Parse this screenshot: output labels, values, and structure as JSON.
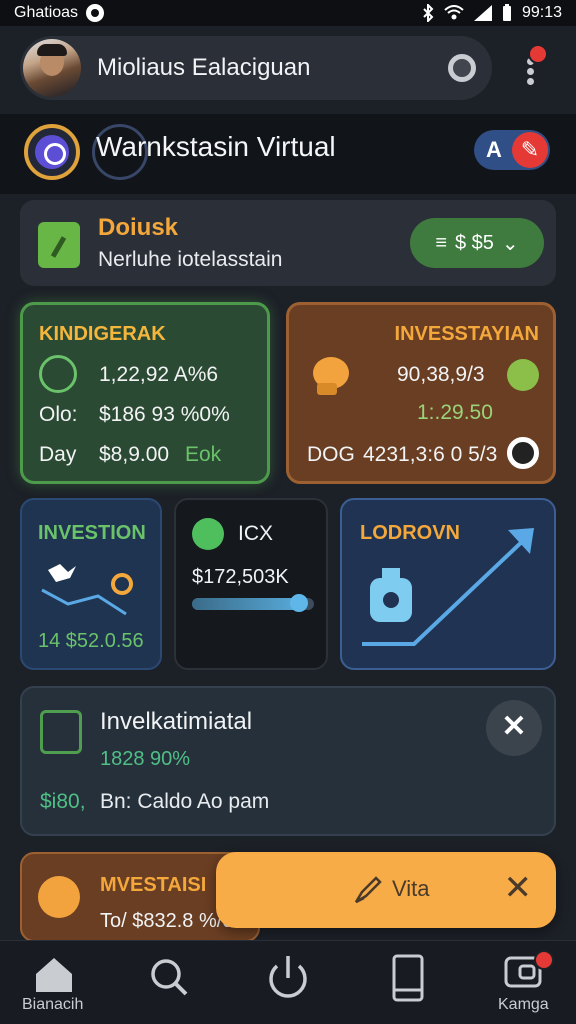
{
  "status_bar": {
    "carrier": "Ghatioas",
    "time": "99:13"
  },
  "profile": {
    "name": "Mioliaus Ealaciguan"
  },
  "app": {
    "title": "Warnkstasin Virtual",
    "action_label": "A"
  },
  "document": {
    "title": "Doiusk",
    "subtitle": "Nerluhe iotelasstain",
    "amount": "$ $5"
  },
  "cards": {
    "kinder": {
      "title": "KINDIGERAK",
      "row1": "1,22,92 A%6",
      "row2_label": "Olo:",
      "row2_value": "$186 93 %0%",
      "row3_label": "Day",
      "row3_value": "$8,9.00",
      "row3_suffix": "Eok"
    },
    "invest": {
      "title": "INVESSTAYIAN",
      "row1": "90,38,9/3",
      "row2": "1:.29.50",
      "row3_label": "DOG",
      "row3_value": "4231,3:6 0 5/3"
    },
    "investion": {
      "title": "INVESTION",
      "value": "14 $52.0.56"
    },
    "icx": {
      "title": "ICX",
      "value": "$172,503K",
      "progress": 0.88
    },
    "lodrovn": {
      "title": "LODROVN"
    }
  },
  "investment": {
    "title": "Invelkatimiatal",
    "percent": "1828 90%",
    "amount": "$i80,",
    "note": "Bn: Caldo Ao pam"
  },
  "bottom_card": {
    "title": "MVESTAISI",
    "subtitle": "To/ $832.8 %/o"
  },
  "toast": {
    "label": "Vita"
  },
  "nav": {
    "items": [
      {
        "label": "Bianacih",
        "icon": "home-icon"
      },
      {
        "label": "",
        "icon": "search-icon"
      },
      {
        "label": "",
        "icon": "power-icon"
      },
      {
        "label": "",
        "icon": "phone-icon"
      },
      {
        "label": "Kamga",
        "icon": "wallet-icon"
      }
    ]
  },
  "colors": {
    "accent_orange": "#f4a83c",
    "accent_green": "#4e9a4c",
    "badge_red": "#e53935",
    "toast": "#f8ac47"
  }
}
